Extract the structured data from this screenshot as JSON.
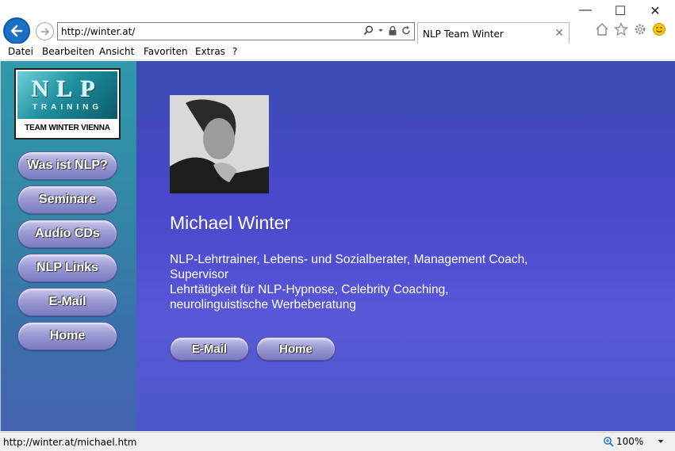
{
  "browser": {
    "address": "http://winter.at/",
    "tab_title": "NLP Team Winter",
    "tab_close": "✕",
    "window_controls": {
      "minimize": "—",
      "maximize": "☐",
      "close": "✕"
    }
  },
  "menu": [
    "Datei",
    "Bearbeiten",
    "Ansicht",
    "Favoriten",
    "Extras",
    "?"
  ],
  "logo": {
    "main": "NLP",
    "sub": "TRAINING",
    "caption": "TEAM WINTER VIENNA"
  },
  "sidebar": {
    "nav": [
      {
        "label": "Was ist NLP?"
      },
      {
        "label": "Seminare"
      },
      {
        "label": "Audio CDs"
      },
      {
        "label": "NLP Links"
      },
      {
        "label": "E-Mail"
      },
      {
        "label": "Home"
      }
    ]
  },
  "main": {
    "name": "Michael Winter",
    "desc_line1": "NLP-Lehrtrainer, Lebens- und Sozialberater, Management Coach,",
    "desc_line2": "Supervisor",
    "desc_line3": "Lehrtätigkeit für NLP-Hypnose, Celebrity Coaching,",
    "desc_line4": "neurolinguistische Werbeberatung",
    "buttons": {
      "email": "E-Mail",
      "home": "Home"
    }
  },
  "status": {
    "url": "http://winter.at/michael.htm",
    "zoom": "100%"
  },
  "colors": {
    "main_bg": "#4a48cc",
    "sidebar_bg": "#3387a6",
    "browser_accent": "#1b6fc5"
  }
}
